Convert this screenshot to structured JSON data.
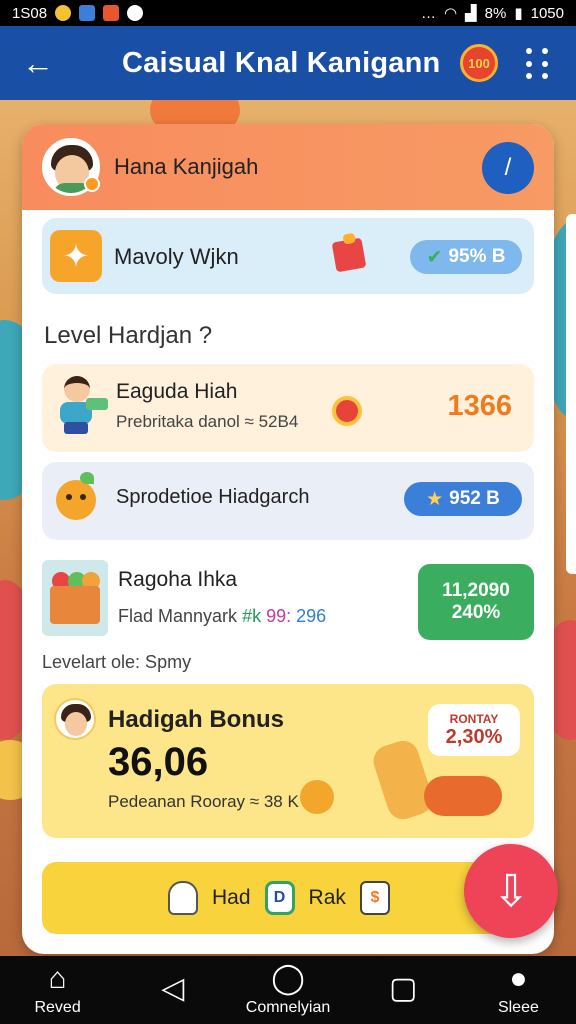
{
  "status_bar": {
    "time": "1S08",
    "battery": "8%",
    "clock": "1050"
  },
  "app_bar": {
    "title": "Caisual Knal Kanigann",
    "badge": "100"
  },
  "profile": {
    "name": "Hana Kanjigah"
  },
  "featured": {
    "title": "Mavoly Wjkn",
    "pill": "95% B"
  },
  "section_title": "Level Hardjan ?",
  "items": [
    {
      "name": "Eaguda Hiah",
      "sub": "Prebritaka danol ≈ 52B4",
      "value": "1366"
    },
    {
      "name": "Sprodetioe Hiadgarch",
      "pill": "952 B"
    },
    {
      "name": "Ragoha Ihka",
      "sub_prefix": "Flad Mannyark",
      "sub_a": "#k",
      "sub_b": "99:",
      "sub_c": "296",
      "box_line1": "11,2090",
      "box_line2": "240%"
    }
  ],
  "level_note": "Levelart ole: Spmy",
  "bonus": {
    "title": "Hadigah Bonus",
    "amount": "36,06",
    "sub": "Pedeanan Rooray ≈ 38 K",
    "bubble_label": "RONTAY",
    "bubble_value": "2,30%"
  },
  "actions": {
    "label_a": "Had",
    "label_d": "D",
    "label_b": "Rak",
    "chat": "$"
  },
  "bottom_nav": {
    "item1": "Reved",
    "item3": "Comnelyian",
    "item5": "Sleee"
  },
  "colors": {
    "app_bar": "#1a4fa6",
    "header": "#f88c5e",
    "accent_orange": "#f07a1e",
    "green": "#3aae5e",
    "fab": "#ef4358"
  }
}
